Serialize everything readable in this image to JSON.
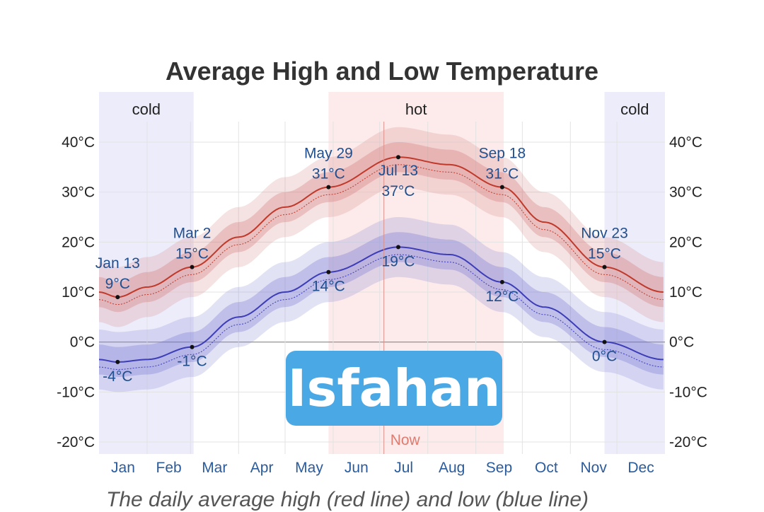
{
  "chart_data": {
    "type": "line",
    "title": "Average High and Low Temperature",
    "ylim": [
      -20,
      40
    ],
    "yticks": [
      "40°C",
      "30°C",
      "20°C",
      "10°C",
      "0°C",
      "-10°C",
      "-20°C"
    ],
    "months": [
      "Jan",
      "Feb",
      "Mar",
      "Apr",
      "May",
      "Jun",
      "Jul",
      "Aug",
      "Sep",
      "Oct",
      "Nov",
      "Dec"
    ],
    "seasons": [
      {
        "label": "cold",
        "start": "Jan 1",
        "end": "Mar 2"
      },
      {
        "label": "hot",
        "start": "May 29",
        "end": "Sep 18"
      },
      {
        "label": "cold",
        "start": "Nov 23",
        "end": "Dec 31"
      }
    ],
    "series": [
      {
        "color": "#c0392b",
        "x": [
          "Jan 1",
          "Jan 13",
          "Feb 1",
          "Mar 2",
          "Apr 1",
          "May 1",
          "May 29",
          "Jul 13",
          "Aug 15",
          "Sep 18",
          "Oct 15",
          "Nov 23",
          "Dec 31"
        ],
        "values": [
          10,
          9,
          11,
          15,
          21,
          27,
          31,
          37,
          35.5,
          31,
          24,
          15,
          10
        ]
      },
      {
        "color": "#3d3db8",
        "x": [
          "Jan 1",
          "Jan 13",
          "Feb 1",
          "Mar 2",
          "Apr 1",
          "May 1",
          "May 29",
          "Jul 13",
          "Aug 15",
          "Sep 18",
          "Oct 15",
          "Nov 23",
          "Dec 31"
        ],
        "values": [
          -3.5,
          -4,
          -3.5,
          -1,
          5,
          10,
          14,
          19,
          17.5,
          12,
          7,
          0,
          -3.5
        ]
      }
    ],
    "annotations": [
      {
        "date": "Jan 13",
        "temp": "9°C",
        "value": 9,
        "label_pos": "above"
      },
      {
        "date": "Mar 2",
        "temp": "15°C",
        "value": 15,
        "label_pos": "above"
      },
      {
        "date": "May 29",
        "temp": "31°C",
        "value": 31,
        "label_pos": "above"
      },
      {
        "date": "Jul 13",
        "temp": "37°C",
        "value": 37,
        "label_pos": "below"
      },
      {
        "date": "Sep 18",
        "temp": "31°C",
        "value": 31,
        "label_pos": "above"
      },
      {
        "date": "Nov 23",
        "temp": "15°C",
        "value": 15,
        "label_pos": "above"
      },
      {
        "date": "",
        "temp": "-4°C",
        "value": -4,
        "x": "Jan 13",
        "label_pos": "below"
      },
      {
        "date": "",
        "temp": "-1°C",
        "value": -1,
        "x": "Mar 2",
        "label_pos": "below"
      },
      {
        "date": "",
        "temp": "14°C",
        "value": 14,
        "x": "May 29",
        "label_pos": "below"
      },
      {
        "date": "",
        "temp": "19°C",
        "value": 19,
        "x": "Jul 13",
        "label_pos": "below"
      },
      {
        "date": "",
        "temp": "12°C",
        "value": 12,
        "x": "Sep 18",
        "label_pos": "below"
      },
      {
        "date": "",
        "temp": "0°C",
        "value": 0,
        "x": "Nov 23",
        "label_pos": "below"
      }
    ],
    "now_label": "Now",
    "now_date": "Jul 1"
  },
  "logo_text": "Isfahan",
  "caption": "The daily average high (red line) and low (blue line)"
}
